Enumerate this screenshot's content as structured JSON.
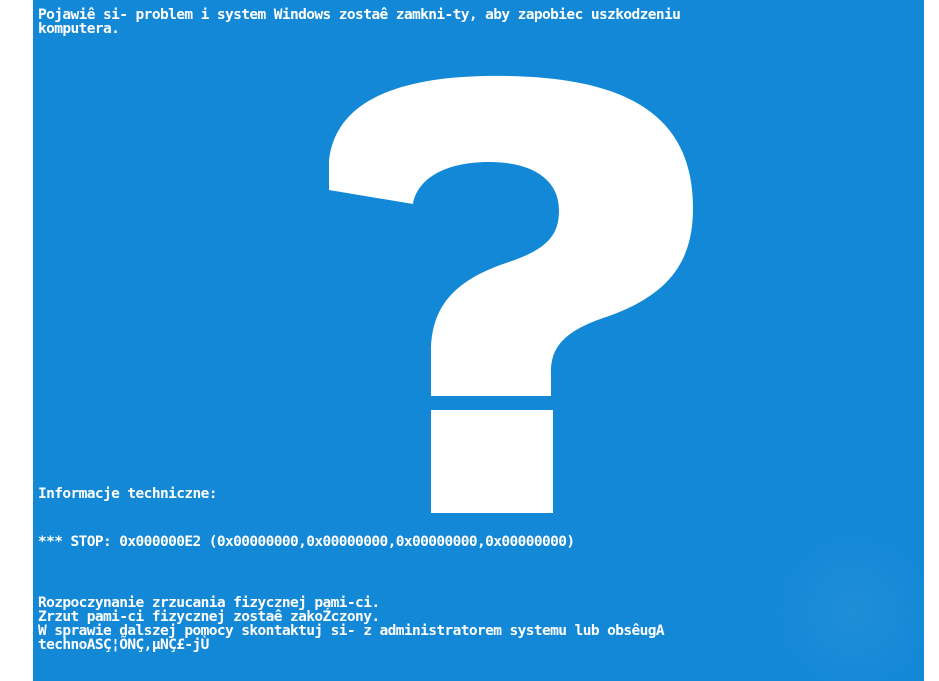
{
  "colors": {
    "background": "#1388d6",
    "text": "#ffffff"
  },
  "header": {
    "line1": "Pojawiê si- problem i system Windows zostaê zamkni-ty, aby zapobiec uszkodzeniu",
    "line2": "komputera."
  },
  "icon": "question-mark-icon",
  "technical_info": {
    "heading": "Informacje techniczne:",
    "stop_line": "*** STOP: 0x000000E2 (0x00000000,0x00000000,0x00000000,0x00000000)"
  },
  "dump": {
    "line1": "Rozpoczynanie zrzucania fizycznej pami-ci.",
    "line2": "Zrzut pami-ci fizycznej zostaê zakoŹczony.",
    "line3": "W sprawie dalszej pomocy skontaktuj si- z administratorem systemu lub obsêugA",
    "line4": "technoASÇ¦ÕNÇ,µNÇ£-jÙ"
  }
}
